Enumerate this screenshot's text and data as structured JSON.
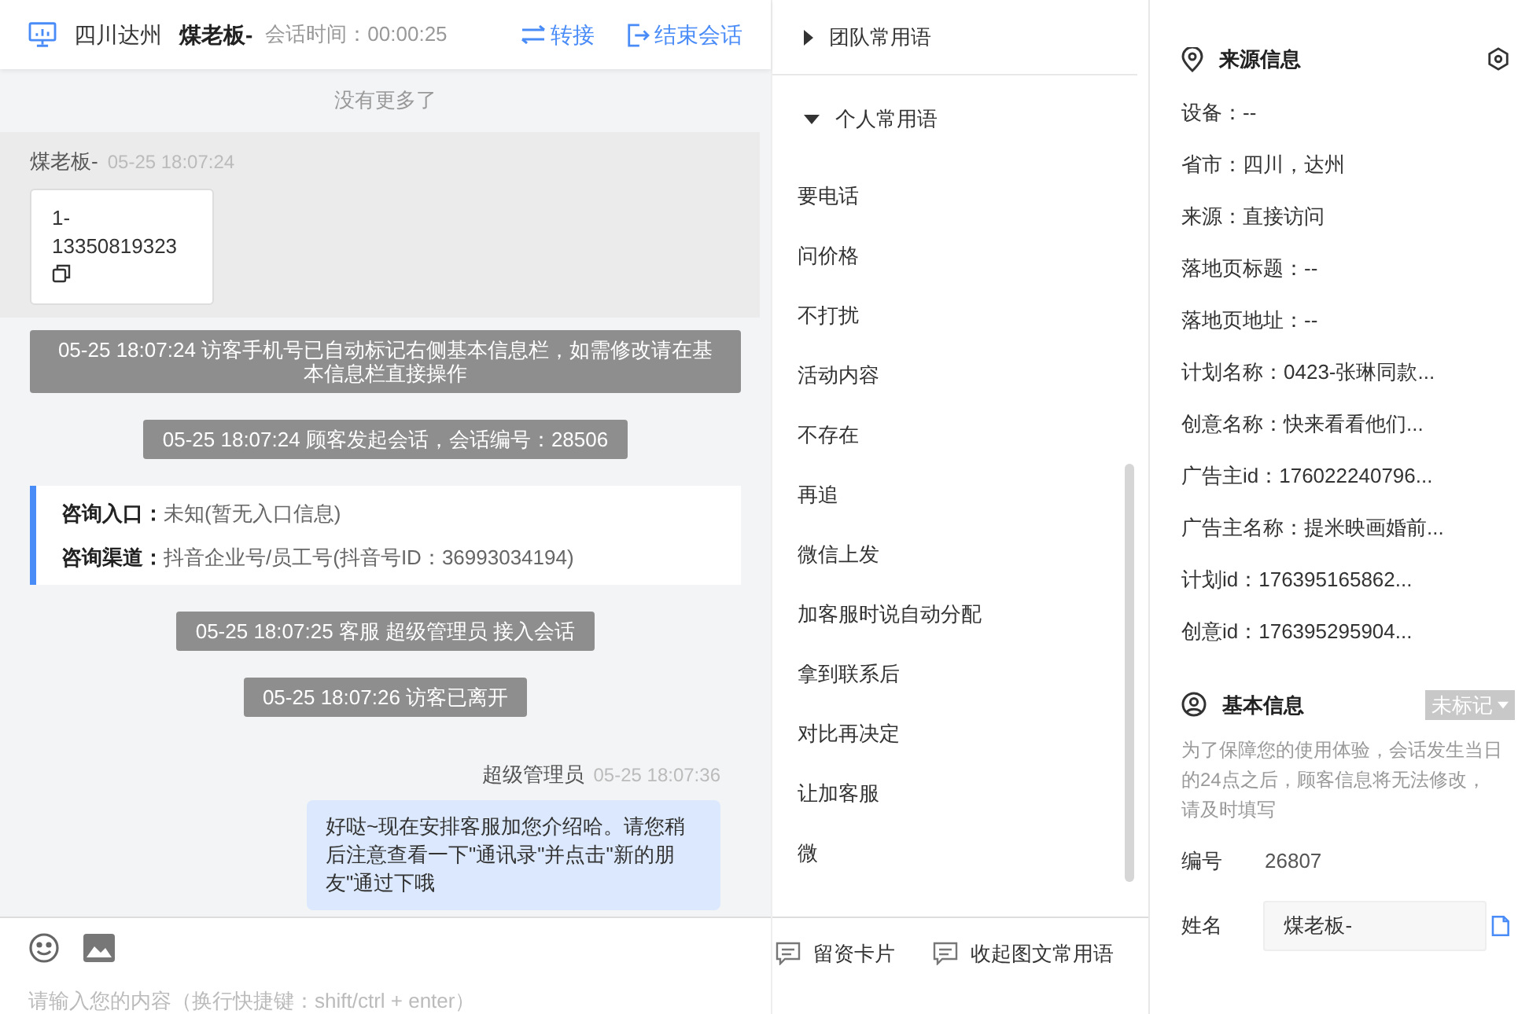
{
  "header": {
    "location": "四川达州",
    "visitor": "煤老板-",
    "session_time": "会话时间：00:00:25",
    "actions": [
      {
        "kind": "transfer",
        "label": "转接"
      },
      {
        "kind": "end",
        "label": "结束会话"
      }
    ]
  },
  "chat": {
    "top_notice": "没有更多了",
    "messages": [
      {
        "kind": "visitor",
        "name": "煤老板-",
        "time": "05-25 18:07:24",
        "card": "1-13350819323"
      },
      {
        "kind": "notice",
        "text": "05-25 18:07:24 访客手机号已自动标记右侧基本信息栏，如需修改请在基本信息栏直接操作"
      },
      {
        "kind": "notice",
        "text": "05-25 18:07:24 顾客发起会话，会话编号：28506"
      },
      {
        "kind": "info",
        "rows": [
          {
            "label": "咨询入口：",
            "value": "未知(暂无入口信息)"
          },
          {
            "label": "咨询渠道：",
            "value": "抖音企业号/员工号(抖音号ID：36993034194)"
          }
        ]
      },
      {
        "kind": "notice",
        "text": "05-25 18:07:25 客服 超级管理员 接入会话"
      },
      {
        "kind": "notice",
        "text": "05-25 18:07:26 访客已离开"
      },
      {
        "kind": "agent",
        "name": "超级管理员",
        "time": "05-25 18:07:36",
        "text": "好哒~现在安排客服加您介绍哈。请您稍后注意查看一下\"通讯录\"并点击\"新的朋友\"通过下哦"
      }
    ],
    "input": {
      "placeholder": "请输入您的内容（换行快捷键：shift/ctrl + enter）"
    }
  },
  "phrases": {
    "groups": [
      {
        "label": "团队常用语",
        "expanded": false
      },
      {
        "label": "个人常用语",
        "expanded": true,
        "children": [
          "要电话",
          "问价格",
          "不打扰",
          "活动内容",
          "不存在",
          "再追",
          "微信上发",
          "加客服时说自动分配",
          "拿到联系后",
          "对比再决定",
          "让加客服",
          "微"
        ]
      }
    ],
    "actions": [
      "留资卡片",
      "收起图文常用语"
    ]
  },
  "source_info": {
    "title": "来源信息",
    "rows": [
      "设备：--",
      "省市：四川，达州",
      "来源：直接访问",
      "落地页标题：--",
      "落地页地址：--",
      "计划名称：0423-张琳同款...",
      "创意名称：快来看看他们...",
      "广告主id：176022240796...",
      "广告主名称：提米映画婚前...",
      "计划id：176395165862...",
      "创意id：176395295904..."
    ]
  },
  "basic_info": {
    "title": "基本信息",
    "tag": "未标记",
    "note": "为了保障您的使用体验，会话发生当日的24点之后，顾客信息将无法修改，请及时填写",
    "fields": [
      {
        "kind": "text",
        "label": "编号",
        "value": "26807"
      },
      {
        "kind": "input",
        "label": "姓名",
        "value": "煤老板-"
      }
    ]
  }
}
